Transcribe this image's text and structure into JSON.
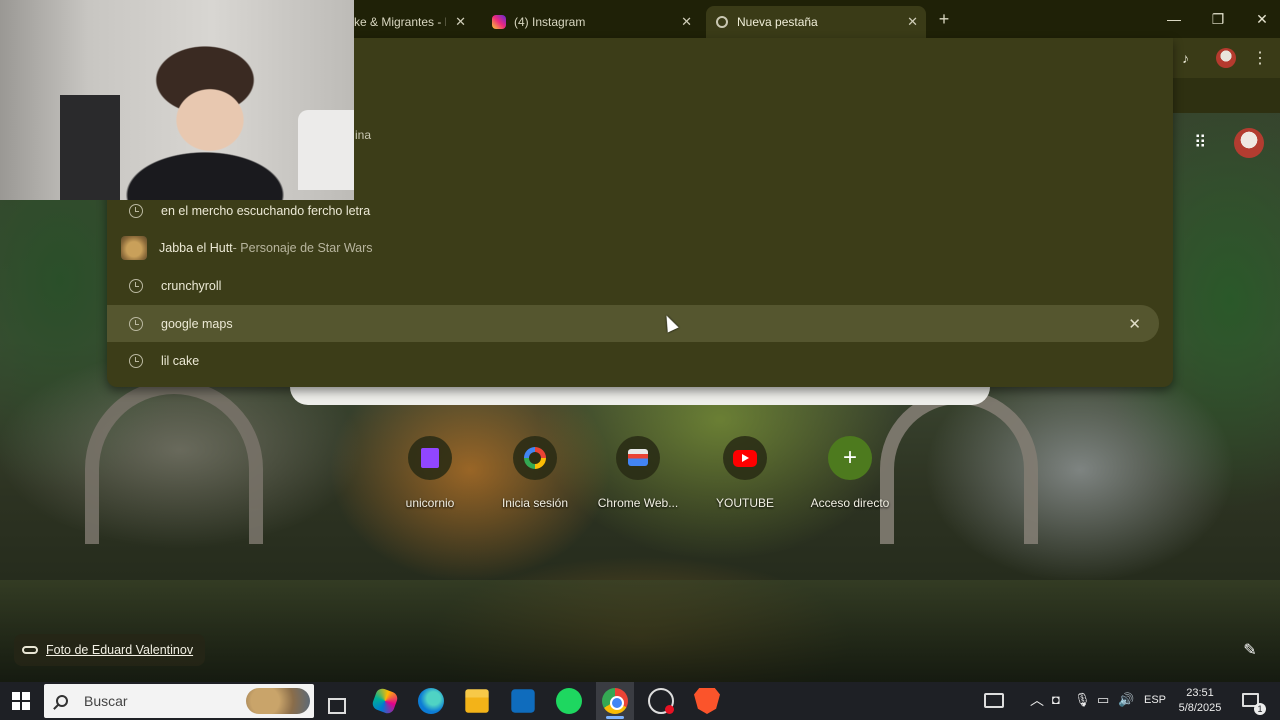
{
  "browser": {
    "tabs": [
      {
        "label": "ke & Migrantes - M",
        "active": false
      },
      {
        "label": "(4) Instagram",
        "active": false
      },
      {
        "label": "Nueva pestaña",
        "active": true
      }
    ],
    "new_tab_icon": "+",
    "window_controls": {
      "minimize": "—",
      "maximize": "❐",
      "close": "✕"
    },
    "toolbar": {
      "media_icon": "♪",
      "menu_icon": "⋮"
    }
  },
  "omnibox": {
    "hint_fragment": "ina",
    "suggestions": [
      {
        "icon": "history-icon",
        "text": "en el mercho escuchando fercho letra",
        "description": ""
      },
      {
        "icon": "thumbnail",
        "text": "Jabba el Hutt",
        "description": " - Personaje de Star Wars"
      },
      {
        "icon": "history-icon",
        "text": "crunchyroll",
        "description": ""
      },
      {
        "icon": "history-icon",
        "text": "google maps",
        "description": "",
        "highlighted": true,
        "remove_icon": "✕"
      },
      {
        "icon": "history-icon",
        "text": "lil cake",
        "description": ""
      }
    ]
  },
  "new_tab_page": {
    "apps_icon": "⠿",
    "shortcuts": [
      {
        "label": "unicornio",
        "icon": "twitch-icon"
      },
      {
        "label": "Inicia sesión",
        "icon": "google-icon"
      },
      {
        "label": "Chrome Web...",
        "icon": "chrome-web-store-icon"
      },
      {
        "label": "YOUTUBE",
        "icon": "youtube-icon"
      },
      {
        "label": "Acceso directo",
        "icon": "plus-icon",
        "glyph": "+"
      }
    ],
    "photo_credit": "Foto de Eduard Valentinov",
    "customize_icon": "✎"
  },
  "taskbar": {
    "search_placeholder": "Buscar",
    "apps": [
      "task-view",
      "copilot",
      "edge",
      "file-explorer",
      "outlook",
      "spotify",
      "chrome",
      "snipping-tool",
      "brave"
    ],
    "tray": {
      "chevron": "︿",
      "meet": "◘",
      "mic": "🎙",
      "network": "▭",
      "volume": "🔊",
      "language": "ESP",
      "time": "23:51",
      "date": "5/8/2025",
      "notification_count": "1"
    }
  }
}
